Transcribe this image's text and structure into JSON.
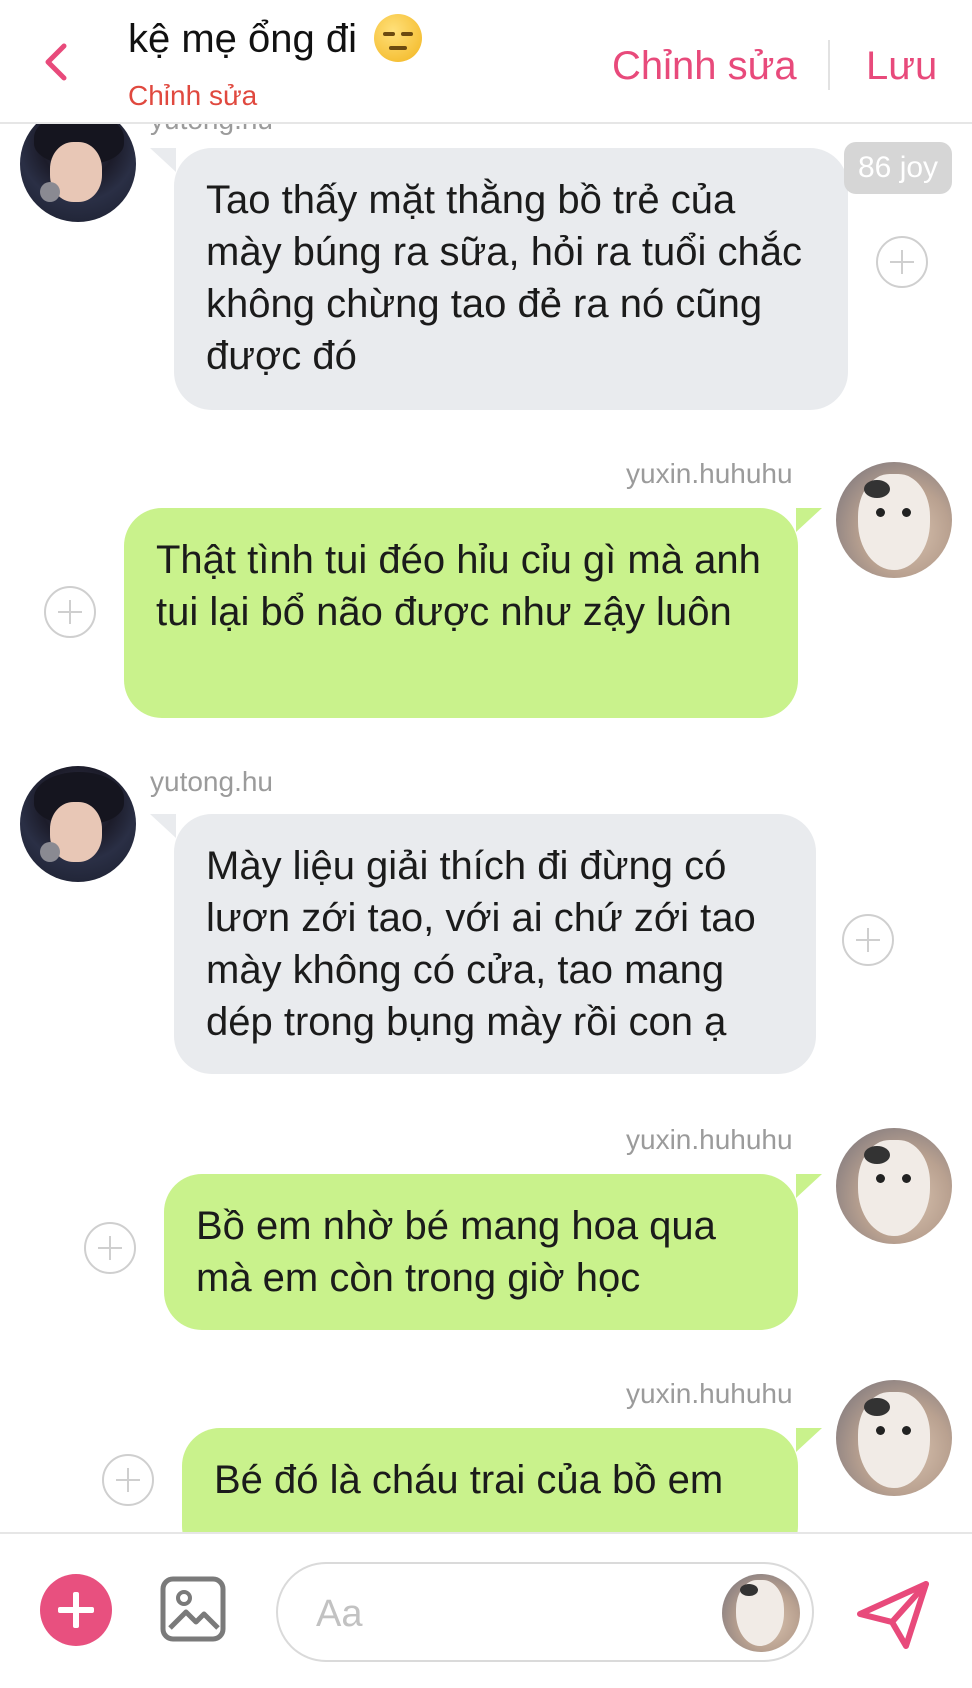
{
  "header": {
    "title": "kệ mẹ ổng đi",
    "emoji": "unamused-face",
    "subtitle": "Chỉnh sửa",
    "edit_label": "Chỉnh sửa",
    "save_label": "Lưu"
  },
  "colors": {
    "accent": "#e84a7b",
    "subtitle": "#e0493f",
    "incoming_bubble": "#e9ebee",
    "outgoing_bubble": "#c9f28c"
  },
  "messages": [
    {
      "direction": "in",
      "user": "yutong.hu",
      "text": "Tao thấy mặt thằng bồ trẻ của mày búng ra sữa, hỏi ra tuổi chắc không chừng tao đẻ ra nó cũng được đó",
      "badge": "86 joy"
    },
    {
      "direction": "out",
      "user": "yuxin.huhuhu",
      "text": "Thật tình tui đéo hỉu cỉu gì mà anh tui lại bổ não được như zậy luôn"
    },
    {
      "direction": "in",
      "user": "yutong.hu",
      "text": "Mày liệu giải thích đi đừng có lươn zới tao, với ai chứ zới tao mày không có cửa, tao mang dép trong bụng mày rồi con ạ"
    },
    {
      "direction": "out",
      "user": "yuxin.huhuhu",
      "text": "Bồ em nhờ bé mang hoa qua mà em còn trong giờ học"
    },
    {
      "direction": "out",
      "user": "yuxin.huhuhu",
      "text": "Bé đó là cháu trai của bồ em"
    }
  ],
  "composer": {
    "placeholder": "Aa"
  }
}
